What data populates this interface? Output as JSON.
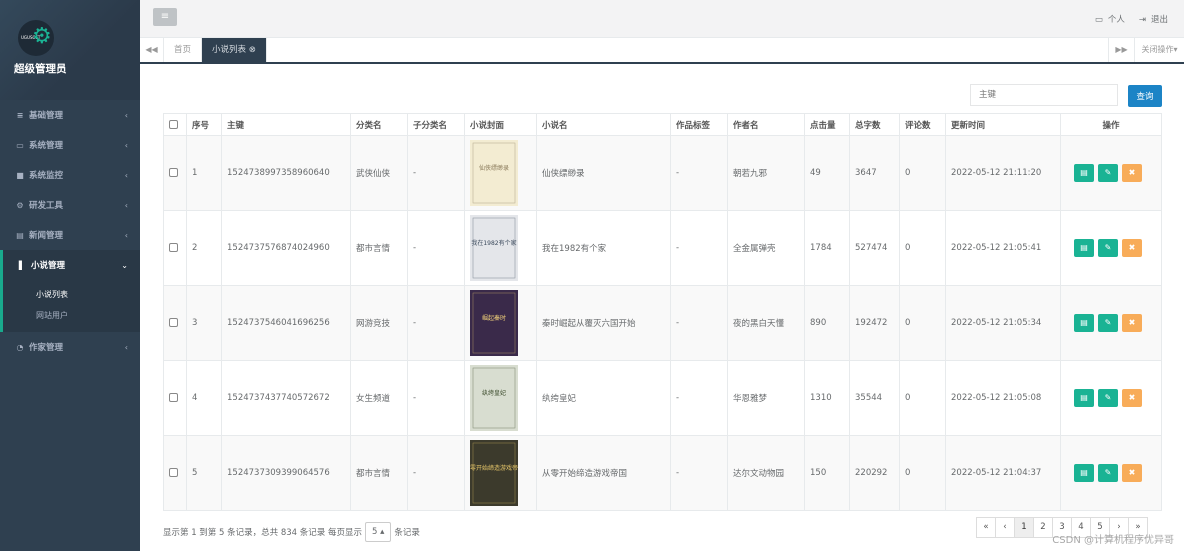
{
  "user": {
    "logo_text": "UGUSOFT",
    "role": "超级管理员"
  },
  "menu": [
    {
      "icon": "≡",
      "label": "基础管理"
    },
    {
      "icon": "▭",
      "label": "系统管理"
    },
    {
      "icon": "■",
      "label": "系统监控"
    },
    {
      "icon": "⚙",
      "label": "研发工具"
    },
    {
      "icon": "▤",
      "label": "新闻管理"
    },
    {
      "icon": "▌",
      "label": "小说管理"
    },
    {
      "icon": "◔",
      "label": "作家管理"
    }
  ],
  "submenu": [
    "小说列表",
    "网站用户"
  ],
  "top": {
    "menu_icon": "≡",
    "personal": "个人",
    "logout": "退出"
  },
  "tabs": {
    "home": "首页",
    "active": "小说列表",
    "close_ops": "关闭操作"
  },
  "search": {
    "placeholder": "主键",
    "button": "查询"
  },
  "table": {
    "headers": [
      "序号",
      "主键",
      "分类名",
      "子分类名",
      "小说封面",
      "小说名",
      "作品标签",
      "作者名",
      "点击量",
      "总字数",
      "评论数",
      "更新时间",
      "操作"
    ],
    "rows": [
      {
        "idx": "1",
        "id": "1524738997358960640",
        "cat": "武侠仙侠",
        "subcat": "-",
        "cover_title": "仙侠缥缈录",
        "name": "仙侠缥缈录",
        "tag": "-",
        "author": "朝若九邪",
        "clicks": "49",
        "words": "3647",
        "comments": "0",
        "updated": "2022-05-12 21:11:20",
        "cover_bg": "#f3ecd2",
        "cover_fg": "#8a7a5a"
      },
      {
        "idx": "2",
        "id": "1524737576874024960",
        "cat": "都市言情",
        "subcat": "-",
        "cover_title": "我在1982有个家",
        "name": "我在1982有个家",
        "tag": "-",
        "author": "全金属弹壳",
        "clicks": "1784",
        "words": "527474",
        "comments": "0",
        "updated": "2022-05-12 21:05:41",
        "cover_bg": "#e4e6ea",
        "cover_fg": "#3b4a5c"
      },
      {
        "idx": "3",
        "id": "1524737546041696256",
        "cat": "网游竞技",
        "subcat": "-",
        "cover_title": "崛起秦时",
        "name": "秦时崛起从覆灭六国开始",
        "tag": "-",
        "author": "夜的黑白天懂",
        "clicks": "890",
        "words": "192472",
        "comments": "0",
        "updated": "2022-05-12 21:05:34",
        "cover_bg": "#3a2a4a",
        "cover_fg": "#f2d27a"
      },
      {
        "idx": "4",
        "id": "1524737437740572672",
        "cat": "女生频道",
        "subcat": "-",
        "cover_title": "纨绔皇妃",
        "name": "纨绔皇妃",
        "tag": "-",
        "author": "华恩雅梦",
        "clicks": "1310",
        "words": "35544",
        "comments": "0",
        "updated": "2022-05-12 21:05:08",
        "cover_bg": "#d8ddd0",
        "cover_fg": "#3a4a2a"
      },
      {
        "idx": "5",
        "id": "1524737309399064576",
        "cat": "都市言情",
        "subcat": "-",
        "cover_title": "从零开始缔造游戏帝国",
        "name": "从零开始缔造游戏帝国",
        "tag": "-",
        "author": "达尔文动物园",
        "clicks": "150",
        "words": "220292",
        "comments": "0",
        "updated": "2022-05-12 21:04:37",
        "cover_bg": "#3c3a2c",
        "cover_fg": "#e7c76a"
      }
    ]
  },
  "actions": {
    "view": "▤",
    "edit": "✎",
    "delete": "✖"
  },
  "footer": {
    "prefix": "显示第 1 到第 5 条记录，总共 834 条记录 每页显示",
    "page_size": "5",
    "suffix": "条记录"
  },
  "pager": [
    "«",
    "‹",
    "1",
    "2",
    "3",
    "4",
    "5",
    "›",
    "»"
  ],
  "watermark": "CSDN @计算机程序优异哥"
}
